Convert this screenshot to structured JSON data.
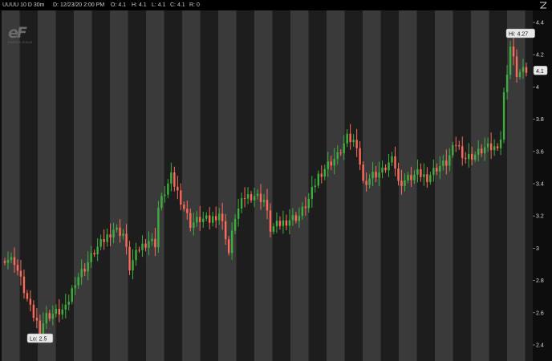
{
  "header": {
    "symbol": "UUUU 10 D 30m",
    "date": "D: 12/23/20 2:00 PM",
    "open": "O: 4.1",
    "high": "H: 4.1",
    "low": "L: 4.1",
    "close": "C: 4.1",
    "volume": "R: 0"
  },
  "logo": {
    "mark": "eF",
    "sub": "ENERGY FUELS"
  },
  "chart_data": {
    "type": "candlestick",
    "symbol": "UUUU",
    "timeframe": "10 D 30m",
    "y_ticks": [
      2.4,
      2.6,
      2.8,
      3,
      3.2,
      3.4,
      3.6,
      3.8,
      4,
      4.2,
      4.4
    ],
    "ylim": [
      2.36,
      4.47
    ],
    "last_price": 4.1,
    "high_marker": "Hi: 4.27",
    "low_marker": "Lo: 2.5",
    "up_color": "#3fae3f",
    "down_color": "#ff6b5a",
    "session_band_colors": [
      "#3a3a3a",
      "#1d1d1d"
    ],
    "anchors": [
      [
        0,
        2.94
      ],
      [
        3,
        2.92
      ],
      [
        5,
        2.8
      ],
      [
        8,
        2.62
      ],
      [
        11,
        2.5
      ],
      [
        13,
        2.58
      ],
      [
        16,
        2.6
      ],
      [
        19,
        2.62
      ],
      [
        22,
        2.8
      ],
      [
        25,
        2.88
      ],
      [
        28,
        2.98
      ],
      [
        31,
        3.05
      ],
      [
        34,
        3.12
      ],
      [
        37,
        3.09
      ],
      [
        39,
        2.88
      ],
      [
        42,
        3.0
      ],
      [
        45,
        3.05
      ],
      [
        47,
        3.03
      ],
      [
        48,
        3.25
      ],
      [
        50,
        3.35
      ],
      [
        52,
        3.44
      ],
      [
        55,
        3.3
      ],
      [
        58,
        3.15
      ],
      [
        61,
        3.18
      ],
      [
        64,
        3.17
      ],
      [
        67,
        3.22
      ],
      [
        69,
        3.08
      ],
      [
        70,
        2.97
      ],
      [
        72,
        3.2
      ],
      [
        75,
        3.32
      ],
      [
        78,
        3.33
      ],
      [
        81,
        3.3
      ],
      [
        83,
        3.12
      ],
      [
        86,
        3.15
      ],
      [
        89,
        3.18
      ],
      [
        92,
        3.2
      ],
      [
        95,
        3.3
      ],
      [
        98,
        3.45
      ],
      [
        101,
        3.52
      ],
      [
        104,
        3.57
      ],
      [
        107,
        3.68
      ],
      [
        110,
        3.65
      ],
      [
        112,
        3.4
      ],
      [
        115,
        3.45
      ],
      [
        118,
        3.47
      ],
      [
        120,
        3.52
      ],
      [
        121,
        3.6
      ],
      [
        123,
        3.4
      ],
      [
        126,
        3.43
      ],
      [
        129,
        3.46
      ],
      [
        132,
        3.44
      ],
      [
        135,
        3.5
      ],
      [
        138,
        3.53
      ],
      [
        141,
        3.65
      ],
      [
        144,
        3.56
      ],
      [
        147,
        3.58
      ],
      [
        150,
        3.62
      ],
      [
        153,
        3.62
      ],
      [
        155,
        3.68
      ],
      [
        156,
        3.95
      ],
      [
        158,
        4.25
      ],
      [
        160,
        4.08
      ],
      [
        163,
        4.1
      ]
    ]
  }
}
